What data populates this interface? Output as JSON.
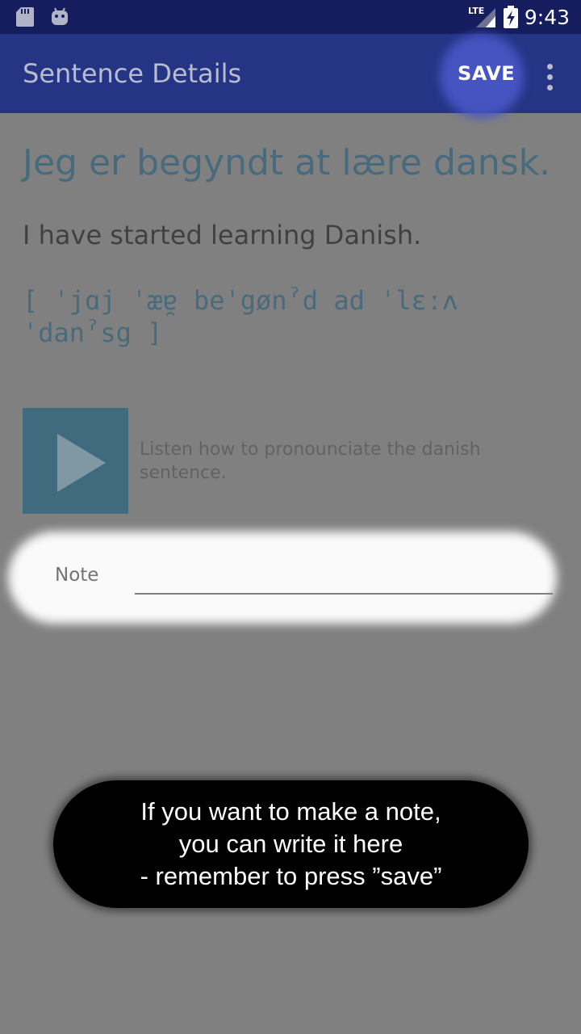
{
  "status_bar": {
    "time": "9:43",
    "network": "LTE",
    "icons": [
      "sd-card-icon",
      "android-icon",
      "signal-icon",
      "battery-charging-icon"
    ]
  },
  "app_bar": {
    "title": "Sentence Details",
    "save_label": "SAVE",
    "more_icon": "more-vert-icon"
  },
  "sentence": {
    "danish": "Jeg er begyndt at lære dansk.",
    "english": "I have started learning Danish.",
    "ipa_line1": "[ ˈjɑj ˈæɐ̯ beˈgønˀd ad ˈlɛːʌ",
    "ipa_line2": "ˈdanˀsg ]"
  },
  "audio": {
    "play_icon": "play-icon",
    "caption": "Listen how to pronounciate the danish sentence."
  },
  "note": {
    "label": "Note",
    "value": ""
  },
  "tutorial": {
    "tooltip_lines": [
      "If you want to make a note,",
      "you can write it here",
      "- remember to press ”save”"
    ]
  },
  "colors": {
    "status_bar": "#161d5e",
    "app_bar": "#253485",
    "accent_text": "#0f5478",
    "play_button": "#01567f",
    "scrim": "#808080"
  }
}
